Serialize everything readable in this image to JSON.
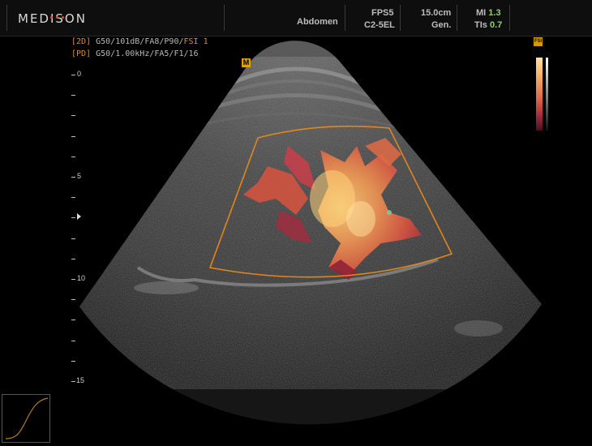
{
  "brand": {
    "name": "MEDISON"
  },
  "header": {
    "preset": "Abdomen",
    "fps": "FPS5",
    "probe": "C2-5EL",
    "depth": "15.0cm",
    "gen": "Gen.",
    "mi_label": "MI",
    "mi_value": "1.3",
    "tis_label": "TIs",
    "tis_value": "0.7"
  },
  "params": {
    "line1_prefix": "[2D]",
    "line1_body": " G50/101dB/FA8/P90/",
    "line1_fsi": "FSI 1",
    "line2_prefix": "[PD]",
    "line2_body": " G50/1.00kHz/FA5/F1/16"
  },
  "markers": {
    "m": "M",
    "fsi_badge": "FSI"
  },
  "depth_scale": {
    "labels": [
      "0",
      "5",
      "10",
      "15"
    ],
    "label_depths": [
      0,
      5,
      10,
      15
    ],
    "max_depth": 15
  },
  "colors": {
    "doppler_box": "#e0861c",
    "power_doppler_high": "#ffd27a",
    "power_doppler_low": "#b5304a",
    "tissue": "#3a3a3a"
  }
}
